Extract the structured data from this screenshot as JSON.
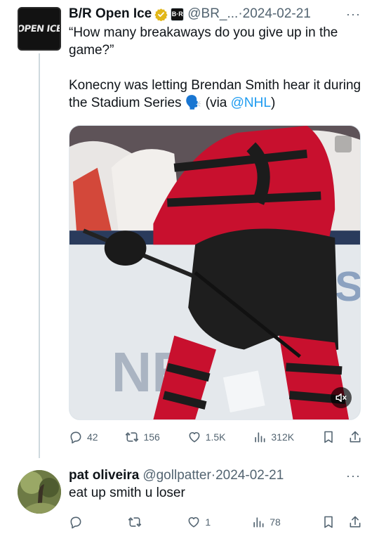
{
  "tweet": {
    "author_name": "B/R Open Ice",
    "handle": "@BR_...",
    "separator": "·",
    "date": "2024-02-21",
    "avatar_text": "OPEN ICE",
    "affiliate_badge_text": "B·R",
    "more_label": "···",
    "text_line1": "“How many breakaways do you give up in the game?”",
    "text_line2_prefix": "Konecny was letting Brendan Smith hear it during the Stadium Series 🗣️ (via ",
    "mention": "@NHL",
    "text_line2_suffix": ")",
    "stats": {
      "replies": "42",
      "retweets": "156",
      "likes": "1.5K",
      "views": "312K"
    }
  },
  "reply": {
    "author_name": "pat oliveira",
    "handle": "@gollpatter",
    "separator": "·",
    "date": "2024-02-21",
    "more_label": "···",
    "text": "eat up smith u loser",
    "stats": {
      "replies": "",
      "retweets": "",
      "likes": "1",
      "views": "78"
    }
  },
  "icons": {
    "reply": "reply-icon",
    "retweet": "retweet-icon",
    "like": "heart-icon",
    "views": "views-icon",
    "bookmark": "bookmark-icon",
    "share": "share-icon",
    "mute": "mute-icon",
    "verified": "verified-badge-icon"
  },
  "colors": {
    "link": "#1d9bf0",
    "verified_gold": "#e2b719",
    "secondary_text": "#536471",
    "jersey_red": "#c8102e"
  }
}
